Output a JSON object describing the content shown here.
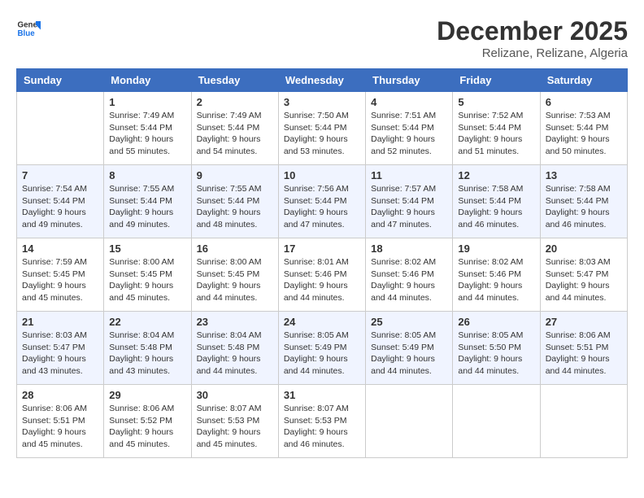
{
  "logo": {
    "line1": "General",
    "line2": "Blue"
  },
  "title": "December 2025",
  "subtitle": "Relizane, Relizane, Algeria",
  "days_of_week": [
    "Sunday",
    "Monday",
    "Tuesday",
    "Wednesday",
    "Thursday",
    "Friday",
    "Saturday"
  ],
  "weeks": [
    [
      {
        "day": "",
        "sunrise": "",
        "sunset": "",
        "daylight": ""
      },
      {
        "day": "1",
        "sunrise": "7:49 AM",
        "sunset": "5:44 PM",
        "daylight": "9 hours and 55 minutes."
      },
      {
        "day": "2",
        "sunrise": "7:49 AM",
        "sunset": "5:44 PM",
        "daylight": "9 hours and 54 minutes."
      },
      {
        "day": "3",
        "sunrise": "7:50 AM",
        "sunset": "5:44 PM",
        "daylight": "9 hours and 53 minutes."
      },
      {
        "day": "4",
        "sunrise": "7:51 AM",
        "sunset": "5:44 PM",
        "daylight": "9 hours and 52 minutes."
      },
      {
        "day": "5",
        "sunrise": "7:52 AM",
        "sunset": "5:44 PM",
        "daylight": "9 hours and 51 minutes."
      },
      {
        "day": "6",
        "sunrise": "7:53 AM",
        "sunset": "5:44 PM",
        "daylight": "9 hours and 50 minutes."
      }
    ],
    [
      {
        "day": "7",
        "sunrise": "7:54 AM",
        "sunset": "5:44 PM",
        "daylight": "9 hours and 49 minutes."
      },
      {
        "day": "8",
        "sunrise": "7:55 AM",
        "sunset": "5:44 PM",
        "daylight": "9 hours and 49 minutes."
      },
      {
        "day": "9",
        "sunrise": "7:55 AM",
        "sunset": "5:44 PM",
        "daylight": "9 hours and 48 minutes."
      },
      {
        "day": "10",
        "sunrise": "7:56 AM",
        "sunset": "5:44 PM",
        "daylight": "9 hours and 47 minutes."
      },
      {
        "day": "11",
        "sunrise": "7:57 AM",
        "sunset": "5:44 PM",
        "daylight": "9 hours and 47 minutes."
      },
      {
        "day": "12",
        "sunrise": "7:58 AM",
        "sunset": "5:44 PM",
        "daylight": "9 hours and 46 minutes."
      },
      {
        "day": "13",
        "sunrise": "7:58 AM",
        "sunset": "5:44 PM",
        "daylight": "9 hours and 46 minutes."
      }
    ],
    [
      {
        "day": "14",
        "sunrise": "7:59 AM",
        "sunset": "5:45 PM",
        "daylight": "9 hours and 45 minutes."
      },
      {
        "day": "15",
        "sunrise": "8:00 AM",
        "sunset": "5:45 PM",
        "daylight": "9 hours and 45 minutes."
      },
      {
        "day": "16",
        "sunrise": "8:00 AM",
        "sunset": "5:45 PM",
        "daylight": "9 hours and 44 minutes."
      },
      {
        "day": "17",
        "sunrise": "8:01 AM",
        "sunset": "5:46 PM",
        "daylight": "9 hours and 44 minutes."
      },
      {
        "day": "18",
        "sunrise": "8:02 AM",
        "sunset": "5:46 PM",
        "daylight": "9 hours and 44 minutes."
      },
      {
        "day": "19",
        "sunrise": "8:02 AM",
        "sunset": "5:46 PM",
        "daylight": "9 hours and 44 minutes."
      },
      {
        "day": "20",
        "sunrise": "8:03 AM",
        "sunset": "5:47 PM",
        "daylight": "9 hours and 44 minutes."
      }
    ],
    [
      {
        "day": "21",
        "sunrise": "8:03 AM",
        "sunset": "5:47 PM",
        "daylight": "9 hours and 43 minutes."
      },
      {
        "day": "22",
        "sunrise": "8:04 AM",
        "sunset": "5:48 PM",
        "daylight": "9 hours and 43 minutes."
      },
      {
        "day": "23",
        "sunrise": "8:04 AM",
        "sunset": "5:48 PM",
        "daylight": "9 hours and 44 minutes."
      },
      {
        "day": "24",
        "sunrise": "8:05 AM",
        "sunset": "5:49 PM",
        "daylight": "9 hours and 44 minutes."
      },
      {
        "day": "25",
        "sunrise": "8:05 AM",
        "sunset": "5:49 PM",
        "daylight": "9 hours and 44 minutes."
      },
      {
        "day": "26",
        "sunrise": "8:05 AM",
        "sunset": "5:50 PM",
        "daylight": "9 hours and 44 minutes."
      },
      {
        "day": "27",
        "sunrise": "8:06 AM",
        "sunset": "5:51 PM",
        "daylight": "9 hours and 44 minutes."
      }
    ],
    [
      {
        "day": "28",
        "sunrise": "8:06 AM",
        "sunset": "5:51 PM",
        "daylight": "9 hours and 45 minutes."
      },
      {
        "day": "29",
        "sunrise": "8:06 AM",
        "sunset": "5:52 PM",
        "daylight": "9 hours and 45 minutes."
      },
      {
        "day": "30",
        "sunrise": "8:07 AM",
        "sunset": "5:53 PM",
        "daylight": "9 hours and 45 minutes."
      },
      {
        "day": "31",
        "sunrise": "8:07 AM",
        "sunset": "5:53 PM",
        "daylight": "9 hours and 46 minutes."
      },
      {
        "day": "",
        "sunrise": "",
        "sunset": "",
        "daylight": ""
      },
      {
        "day": "",
        "sunrise": "",
        "sunset": "",
        "daylight": ""
      },
      {
        "day": "",
        "sunrise": "",
        "sunset": "",
        "daylight": ""
      }
    ]
  ]
}
